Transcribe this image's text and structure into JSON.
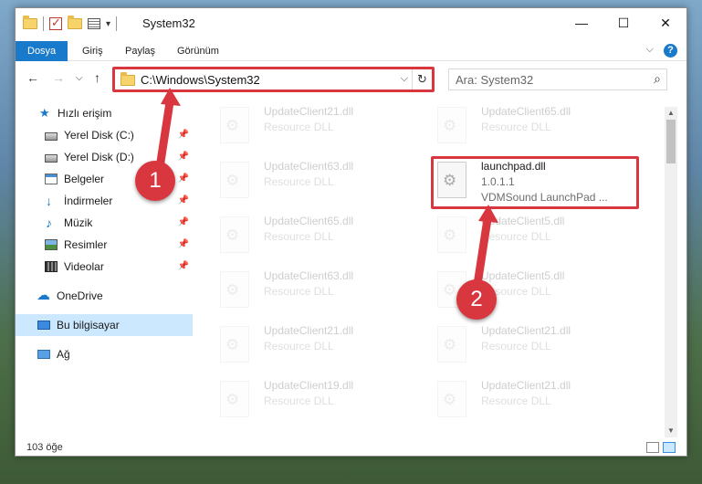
{
  "window": {
    "title": "System32",
    "controls": {
      "minimize": "—",
      "maximize": "☐",
      "close": "✕"
    }
  },
  "ribbon": {
    "tabs": [
      "Dosya",
      "Giriş",
      "Paylaş",
      "Görünüm"
    ],
    "active_tab": "Dosya",
    "help": "?"
  },
  "address": {
    "path": "C:\\Windows\\System32",
    "dropdown": "⌵",
    "refresh": "↻"
  },
  "search": {
    "placeholder": "Ara: System32"
  },
  "sidebar": {
    "items": [
      {
        "label": "Hızlı erişim",
        "icon": "star-icon"
      },
      {
        "label": "Yerel Disk (C:)",
        "icon": "drive-icon",
        "pinned": true
      },
      {
        "label": "Yerel Disk (D:)",
        "icon": "drive-icon",
        "pinned": true
      },
      {
        "label": "Belgeler",
        "icon": "documents-icon",
        "pinned": true
      },
      {
        "label": "İndirmeler",
        "icon": "download-icon",
        "pinned": true
      },
      {
        "label": "Müzik",
        "icon": "music-icon",
        "pinned": true
      },
      {
        "label": "Resimler",
        "icon": "pictures-icon",
        "pinned": true
      },
      {
        "label": "Videolar",
        "icon": "video-icon",
        "pinned": true
      },
      {
        "label": "OneDrive",
        "icon": "cloud-icon"
      },
      {
        "label": "Bu bilgisayar",
        "icon": "computer-icon",
        "selected": true
      },
      {
        "label": "Ağ",
        "icon": "network-icon"
      }
    ]
  },
  "files": {
    "left": [
      {
        "name": "UpdateClient21.dll",
        "type": "Resource DLL"
      },
      {
        "name": "UpdateClient63.dll",
        "type": "Resource DLL"
      },
      {
        "name": "UpdateClient65.dll",
        "type": "Resource DLL"
      },
      {
        "name": "UpdateClient63.dll",
        "type": "Resource DLL"
      },
      {
        "name": "UpdateClient21.dll",
        "type": "Resource DLL"
      },
      {
        "name": "UpdateClient19.dll",
        "type": "Resource DLL"
      }
    ],
    "right": [
      {
        "name": "UpdateClient65.dll",
        "type": "Resource DLL"
      },
      {
        "name": "UpdateClient5.dll",
        "type": "Resource DLL"
      },
      {
        "name": "UpdateClient5.dll",
        "type": "Resource DLL"
      },
      {
        "name": "UpdateClient21.dll",
        "type": "Resource DLL"
      },
      {
        "name": "UpdateClient21.dll",
        "type": "Resource DLL"
      }
    ],
    "highlighted": {
      "name": "launchpad.dll",
      "version": "1.0.1.1",
      "description": "VDMSound LaunchPad ..."
    }
  },
  "status": {
    "item_count": "103 öğe"
  },
  "callouts": [
    "1",
    "2"
  ],
  "colors": {
    "accent": "#1979ca",
    "highlight": "#d9373f",
    "selected": "#cce8ff"
  }
}
